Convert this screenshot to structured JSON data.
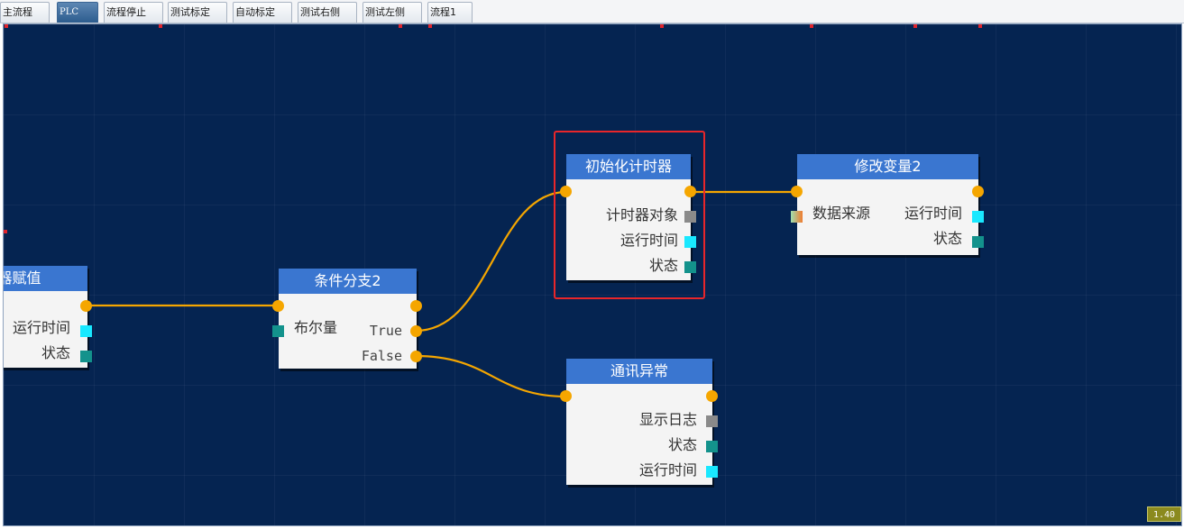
{
  "tabs": [
    "主流程",
    "PLC",
    "流程停止",
    "测试标定",
    "自动标定",
    "测试右侧",
    "测试左侧",
    "流程1"
  ],
  "active_tab": "PLC",
  "nodes": {
    "register_assign": {
      "title": "寄存器赋值",
      "rows": [
        "运行时间",
        "状态"
      ]
    },
    "cond_branch": {
      "title": "条件分支2",
      "input_label": "布尔量",
      "true_label": "True",
      "false_label": "False"
    },
    "init_timer": {
      "title": "初始化计时器",
      "rows": [
        "计时器对象",
        "运行时间",
        "状态"
      ]
    },
    "modify_var": {
      "title": "修改变量2",
      "input_label": "数据来源",
      "rows": [
        "运行时间",
        "状态"
      ]
    },
    "comm_error": {
      "title": "通讯异常",
      "rows": [
        "显示日志",
        "状态",
        "运行时间"
      ]
    }
  },
  "colors": {
    "canvas_bg": "#052451",
    "node_header": "#3a76d0",
    "wire": "#f5a600",
    "selection": "#e8262a",
    "port_cyan": "#19e8ff",
    "port_teal": "#13928c"
  },
  "zoom": "1.40"
}
